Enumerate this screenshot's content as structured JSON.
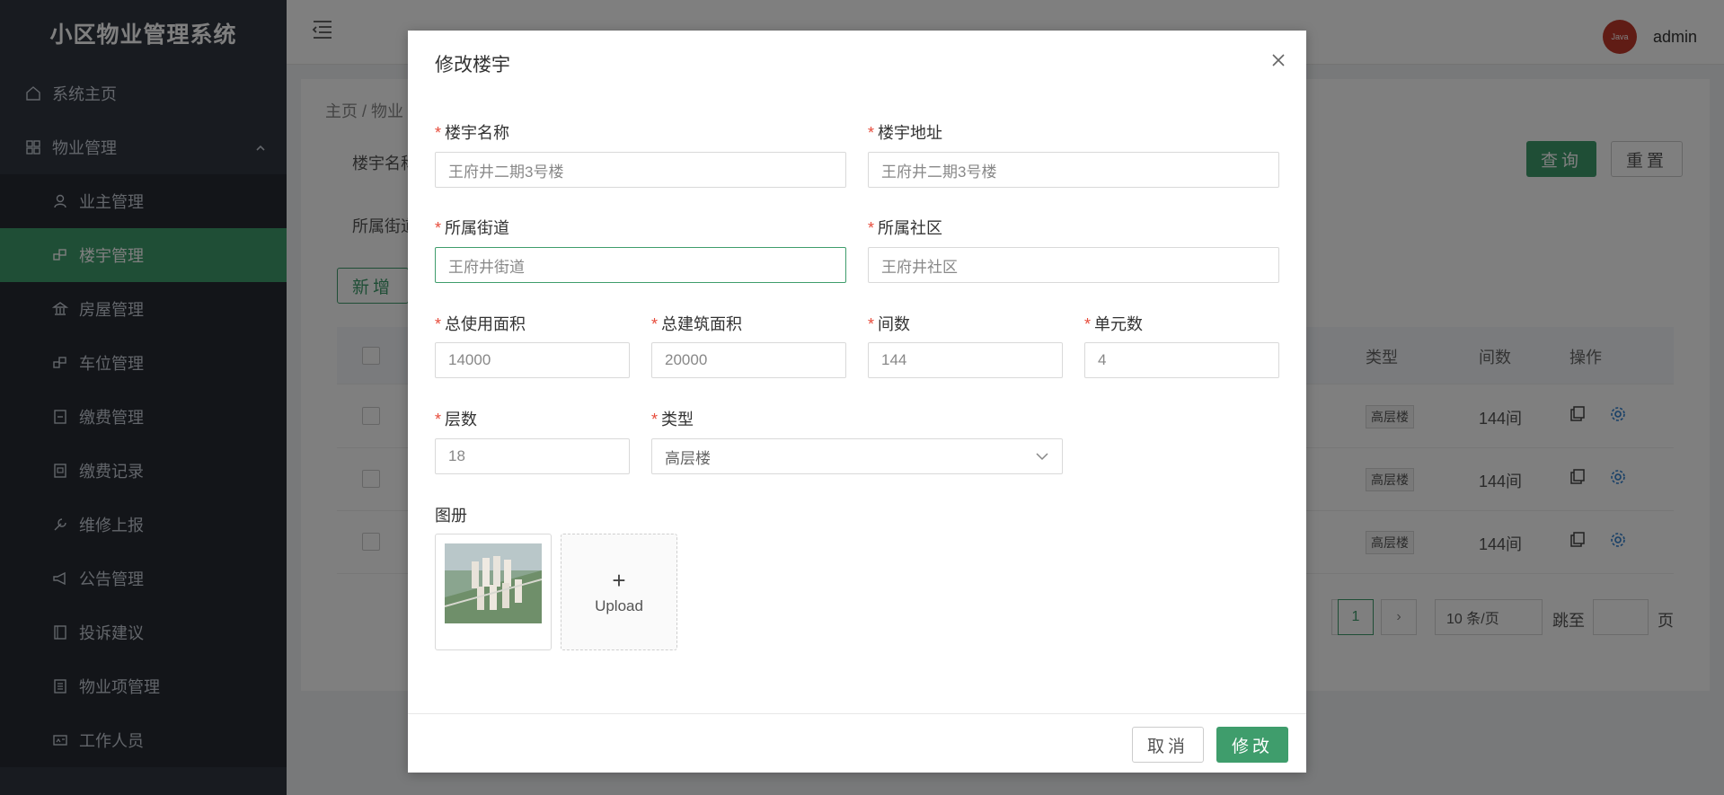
{
  "app": {
    "title": "小区物业管理系统"
  },
  "sidebar": {
    "home": "系统主页",
    "group": "物业管理",
    "items": [
      {
        "label": "业主管理",
        "icon": "user-icon"
      },
      {
        "label": "楼宇管理",
        "icon": "building-icon",
        "active": true
      },
      {
        "label": "房屋管理",
        "icon": "bank-icon"
      },
      {
        "label": "车位管理",
        "icon": "parking-icon"
      },
      {
        "label": "缴费管理",
        "icon": "bill-icon"
      },
      {
        "label": "缴费记录",
        "icon": "record-icon"
      },
      {
        "label": "维修上报",
        "icon": "wrench-icon"
      },
      {
        "label": "公告管理",
        "icon": "megaphone-icon"
      },
      {
        "label": "投诉建议",
        "icon": "document-icon"
      },
      {
        "label": "物业项管理",
        "icon": "list-icon"
      },
      {
        "label": "工作人员",
        "icon": "id-card-icon"
      }
    ]
  },
  "header": {
    "username": "admin",
    "avatar_text": "Java"
  },
  "main": {
    "breadcrumb": "主页 / 物业",
    "filter_building_label": "楼宇名称",
    "filter_street_label": "所属街道",
    "query_label": "查询",
    "reset_label": "重置",
    "add_label": "新增",
    "table": {
      "headers": {
        "type": "类型",
        "rooms": "间数",
        "actions": "操作"
      },
      "rows": [
        {
          "type": "高层楼",
          "rooms": "144间"
        },
        {
          "type": "高层楼",
          "rooms": "144间"
        },
        {
          "type": "高层楼",
          "rooms": "144间"
        }
      ]
    },
    "pagination": {
      "current": "1",
      "page_size": "10 条/页",
      "jump_label": "跳至",
      "page_suffix": "页"
    }
  },
  "dialog": {
    "title": "修改楼宇",
    "fields": {
      "building_name": {
        "label": "楼宇名称",
        "value": "王府井二期3号楼"
      },
      "building_address": {
        "label": "楼宇地址",
        "value": "王府井二期3号楼"
      },
      "street": {
        "label": "所属街道",
        "value": "王府井街道"
      },
      "community": {
        "label": "所属社区",
        "value": "王府井社区"
      },
      "total_use_area": {
        "label": "总使用面积",
        "value": "14000"
      },
      "total_build_area": {
        "label": "总建筑面积",
        "value": "20000"
      },
      "rooms": {
        "label": "间数",
        "value": "144"
      },
      "units": {
        "label": "单元数",
        "value": "4"
      },
      "floors": {
        "label": "层数",
        "value": "18"
      },
      "type": {
        "label": "类型",
        "value": "高层楼"
      }
    },
    "album_label": "图册",
    "upload_label": "Upload",
    "cancel_label": "取消",
    "submit_label": "修改"
  },
  "colors": {
    "accent": "#3f9d6c",
    "sidebar_bg": "#303640",
    "required": "#e74c3c"
  }
}
